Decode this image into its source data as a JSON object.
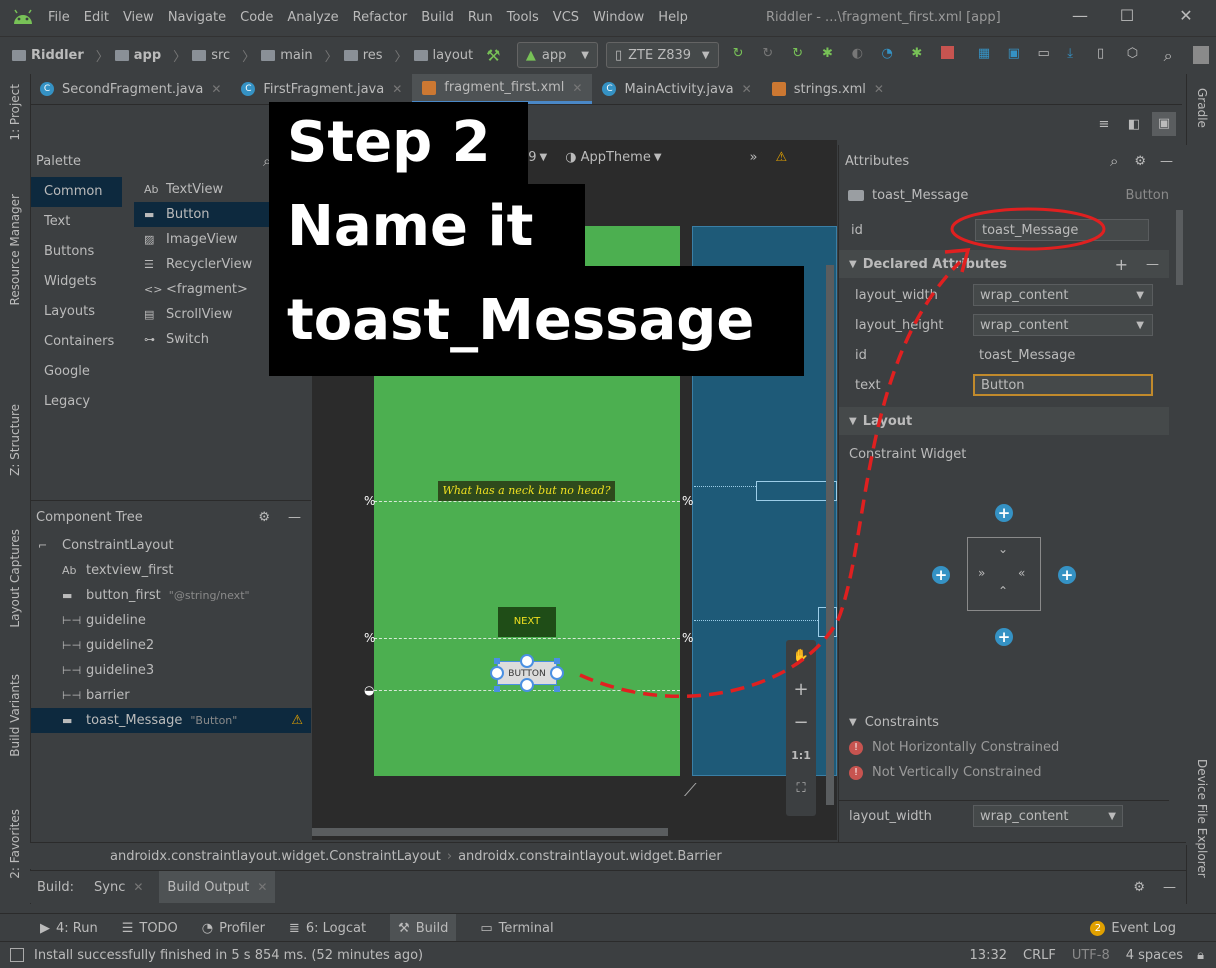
{
  "menu": [
    "File",
    "Edit",
    "View",
    "Navigate",
    "Code",
    "Analyze",
    "Refactor",
    "Build",
    "Run",
    "Tools",
    "VCS",
    "Window",
    "Help"
  ],
  "window_title": "Riddler - ...\\fragment_first.xml [app]",
  "nav": {
    "crumbs": [
      "Riddler",
      "app",
      "src",
      "main",
      "res",
      "layout"
    ],
    "run_config": "app",
    "device": "ZTE Z839"
  },
  "tabs": [
    {
      "label": "SecondFragment.java",
      "kind": "class"
    },
    {
      "label": "FirstFragment.java",
      "kind": "class"
    },
    {
      "label": "fragment_first.xml",
      "kind": "xml",
      "active": true
    },
    {
      "label": "MainActivity.java",
      "kind": "class"
    },
    {
      "label": "strings.xml",
      "kind": "xml"
    }
  ],
  "left_strip": [
    "1: Project",
    "Resource Manager",
    "Z: Structure",
    "Layout Captures",
    "Build Variants",
    "2: Favorites"
  ],
  "right_strip": [
    "Gradle",
    "Device File Explorer"
  ],
  "palette": {
    "title": "Palette",
    "categories": [
      "Common",
      "Text",
      "Buttons",
      "Widgets",
      "Layouts",
      "Containers",
      "Google",
      "Legacy"
    ],
    "items": [
      {
        "icon": "Ab",
        "label": "TextView"
      },
      {
        "icon": "btn",
        "label": "Button"
      },
      {
        "icon": "img",
        "label": "ImageView"
      },
      {
        "icon": "list",
        "label": "RecyclerView"
      },
      {
        "icon": "<>",
        "label": "<fragment>"
      },
      {
        "icon": "scroll",
        "label": "ScrollView"
      },
      {
        "icon": "switch",
        "label": "Switch"
      }
    ]
  },
  "design_toolbar": {
    "api": "29",
    "theme": "AppTheme"
  },
  "component_tree": {
    "title": "Component Tree",
    "items": [
      {
        "icon": "layout",
        "label": "ConstraintLayout",
        "indent": 0
      },
      {
        "icon": "Ab",
        "label": "textview_first",
        "indent": 1
      },
      {
        "icon": "btn",
        "label": "button_first",
        "hint": "\"@string/next\"",
        "indent": 1
      },
      {
        "icon": "guide",
        "label": "guideline",
        "indent": 1
      },
      {
        "icon": "guide",
        "label": "guideline2",
        "indent": 1
      },
      {
        "icon": "guide",
        "label": "guideline3",
        "indent": 1
      },
      {
        "icon": "barrier",
        "label": "barrier",
        "indent": 1
      },
      {
        "icon": "btn",
        "label": "toast_Message",
        "hint": "\"Button\"",
        "indent": 1,
        "selected": true,
        "warning": true
      }
    ]
  },
  "canvas": {
    "question_text": "What has a neck but no head?",
    "next_label": "NEXT",
    "button_label": "BUTTON",
    "zoom_tools": [
      "hand",
      "+",
      "−",
      "1:1",
      "fit"
    ]
  },
  "attributes": {
    "title": "Attributes",
    "component_name": "toast_Message",
    "component_type": "Button",
    "id_label": "id",
    "id_value": "toast_Message",
    "declared_title": "Declared Attributes",
    "declared": [
      {
        "key": "layout_width",
        "value": "wrap_content",
        "dropdown": true
      },
      {
        "key": "layout_height",
        "value": "wrap_content",
        "dropdown": true
      },
      {
        "key": "id",
        "value": "toast_Message"
      },
      {
        "key": "text",
        "value": "Button",
        "highlight": true
      }
    ],
    "layout_title": "Layout",
    "constraint_widget": "Constraint Widget",
    "constraints_title": "Constraints",
    "errors": [
      "Not Horizontally Constrained",
      "Not Vertically Constrained"
    ],
    "bottom_key": "layout_width",
    "bottom_value": "wrap_content"
  },
  "breadcrumb_bottom": [
    "androidx.constraintlayout.widget.ConstraintLayout",
    "androidx.constraintlayout.widget.Barrier"
  ],
  "build": {
    "label": "Build:",
    "tabs": [
      "Sync",
      "Build Output"
    ]
  },
  "tool_windows": [
    {
      "label": "4: Run"
    },
    {
      "label": "TODO"
    },
    {
      "label": "Profiler"
    },
    {
      "label": "6: Logcat"
    },
    {
      "label": "Build",
      "selected": true
    },
    {
      "label": "Terminal"
    }
  ],
  "event_log": {
    "count": "2",
    "label": "Event Log"
  },
  "status": {
    "message": "Install successfully finished in 5 s 854 ms. (52 minutes ago)",
    "position": "13:32",
    "line_sep": "CRLF",
    "encoding": "UTF-8",
    "indent": "4 spaces"
  },
  "overlay": {
    "line1": "Step 2",
    "line2": "Name it",
    "line3": "toast_Message"
  },
  "colors": {
    "accent": "#4a88c7",
    "annotation": "#e02020",
    "green": "#4caf50",
    "blueprint": "#1e5a78"
  }
}
